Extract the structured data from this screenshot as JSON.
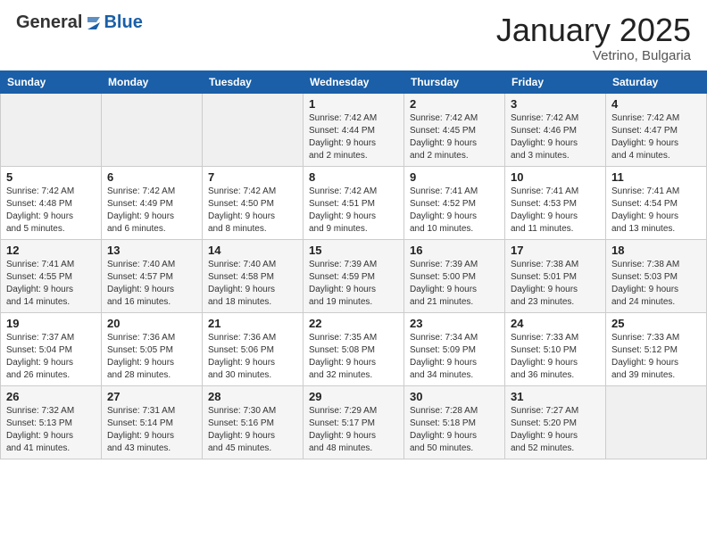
{
  "header": {
    "logo_general": "General",
    "logo_blue": "Blue",
    "month": "January 2025",
    "location": "Vetrino, Bulgaria"
  },
  "weekdays": [
    "Sunday",
    "Monday",
    "Tuesday",
    "Wednesday",
    "Thursday",
    "Friday",
    "Saturday"
  ],
  "weeks": [
    [
      {
        "day": "",
        "info": ""
      },
      {
        "day": "",
        "info": ""
      },
      {
        "day": "",
        "info": ""
      },
      {
        "day": "1",
        "info": "Sunrise: 7:42 AM\nSunset: 4:44 PM\nDaylight: 9 hours\nand 2 minutes."
      },
      {
        "day": "2",
        "info": "Sunrise: 7:42 AM\nSunset: 4:45 PM\nDaylight: 9 hours\nand 2 minutes."
      },
      {
        "day": "3",
        "info": "Sunrise: 7:42 AM\nSunset: 4:46 PM\nDaylight: 9 hours\nand 3 minutes."
      },
      {
        "day": "4",
        "info": "Sunrise: 7:42 AM\nSunset: 4:47 PM\nDaylight: 9 hours\nand 4 minutes."
      }
    ],
    [
      {
        "day": "5",
        "info": "Sunrise: 7:42 AM\nSunset: 4:48 PM\nDaylight: 9 hours\nand 5 minutes."
      },
      {
        "day": "6",
        "info": "Sunrise: 7:42 AM\nSunset: 4:49 PM\nDaylight: 9 hours\nand 6 minutes."
      },
      {
        "day": "7",
        "info": "Sunrise: 7:42 AM\nSunset: 4:50 PM\nDaylight: 9 hours\nand 8 minutes."
      },
      {
        "day": "8",
        "info": "Sunrise: 7:42 AM\nSunset: 4:51 PM\nDaylight: 9 hours\nand 9 minutes."
      },
      {
        "day": "9",
        "info": "Sunrise: 7:41 AM\nSunset: 4:52 PM\nDaylight: 9 hours\nand 10 minutes."
      },
      {
        "day": "10",
        "info": "Sunrise: 7:41 AM\nSunset: 4:53 PM\nDaylight: 9 hours\nand 11 minutes."
      },
      {
        "day": "11",
        "info": "Sunrise: 7:41 AM\nSunset: 4:54 PM\nDaylight: 9 hours\nand 13 minutes."
      }
    ],
    [
      {
        "day": "12",
        "info": "Sunrise: 7:41 AM\nSunset: 4:55 PM\nDaylight: 9 hours\nand 14 minutes."
      },
      {
        "day": "13",
        "info": "Sunrise: 7:40 AM\nSunset: 4:57 PM\nDaylight: 9 hours\nand 16 minutes."
      },
      {
        "day": "14",
        "info": "Sunrise: 7:40 AM\nSunset: 4:58 PM\nDaylight: 9 hours\nand 18 minutes."
      },
      {
        "day": "15",
        "info": "Sunrise: 7:39 AM\nSunset: 4:59 PM\nDaylight: 9 hours\nand 19 minutes."
      },
      {
        "day": "16",
        "info": "Sunrise: 7:39 AM\nSunset: 5:00 PM\nDaylight: 9 hours\nand 21 minutes."
      },
      {
        "day": "17",
        "info": "Sunrise: 7:38 AM\nSunset: 5:01 PM\nDaylight: 9 hours\nand 23 minutes."
      },
      {
        "day": "18",
        "info": "Sunrise: 7:38 AM\nSunset: 5:03 PM\nDaylight: 9 hours\nand 24 minutes."
      }
    ],
    [
      {
        "day": "19",
        "info": "Sunrise: 7:37 AM\nSunset: 5:04 PM\nDaylight: 9 hours\nand 26 minutes."
      },
      {
        "day": "20",
        "info": "Sunrise: 7:36 AM\nSunset: 5:05 PM\nDaylight: 9 hours\nand 28 minutes."
      },
      {
        "day": "21",
        "info": "Sunrise: 7:36 AM\nSunset: 5:06 PM\nDaylight: 9 hours\nand 30 minutes."
      },
      {
        "day": "22",
        "info": "Sunrise: 7:35 AM\nSunset: 5:08 PM\nDaylight: 9 hours\nand 32 minutes."
      },
      {
        "day": "23",
        "info": "Sunrise: 7:34 AM\nSunset: 5:09 PM\nDaylight: 9 hours\nand 34 minutes."
      },
      {
        "day": "24",
        "info": "Sunrise: 7:33 AM\nSunset: 5:10 PM\nDaylight: 9 hours\nand 36 minutes."
      },
      {
        "day": "25",
        "info": "Sunrise: 7:33 AM\nSunset: 5:12 PM\nDaylight: 9 hours\nand 39 minutes."
      }
    ],
    [
      {
        "day": "26",
        "info": "Sunrise: 7:32 AM\nSunset: 5:13 PM\nDaylight: 9 hours\nand 41 minutes."
      },
      {
        "day": "27",
        "info": "Sunrise: 7:31 AM\nSunset: 5:14 PM\nDaylight: 9 hours\nand 43 minutes."
      },
      {
        "day": "28",
        "info": "Sunrise: 7:30 AM\nSunset: 5:16 PM\nDaylight: 9 hours\nand 45 minutes."
      },
      {
        "day": "29",
        "info": "Sunrise: 7:29 AM\nSunset: 5:17 PM\nDaylight: 9 hours\nand 48 minutes."
      },
      {
        "day": "30",
        "info": "Sunrise: 7:28 AM\nSunset: 5:18 PM\nDaylight: 9 hours\nand 50 minutes."
      },
      {
        "day": "31",
        "info": "Sunrise: 7:27 AM\nSunset: 5:20 PM\nDaylight: 9 hours\nand 52 minutes."
      },
      {
        "day": "",
        "info": ""
      }
    ]
  ]
}
